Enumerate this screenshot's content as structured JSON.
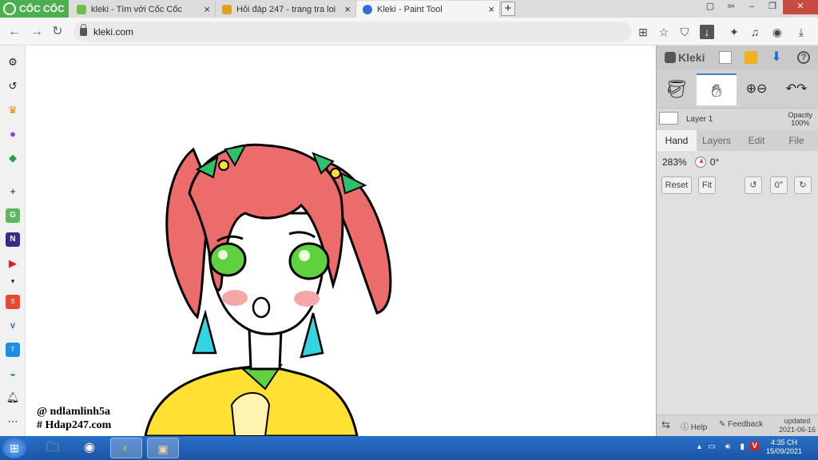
{
  "browser": {
    "brand": "CỐC CỐC",
    "tabs": [
      {
        "title": "kleki - Tìm với Cốc Cốc",
        "favicon": "coccoc-search-icon",
        "active": false
      },
      {
        "title": "Hỏi đáp 247 - trang tra loi",
        "favicon": "hoidap-icon",
        "active": false
      },
      {
        "title": "Kleki - Paint Tool",
        "favicon": "kleki-icon",
        "active": true
      }
    ],
    "new_tab": "+",
    "url": "kleki.com"
  },
  "canvas": {
    "watermark_line1": "@ ndlamlinh5a",
    "watermark_line2": "# Hdap247.com"
  },
  "kleki": {
    "logo": "Kleki",
    "layer_name": "Layer 1",
    "opacity_label": "Opacity",
    "opacity_value": "100%",
    "tabs": [
      "Hand",
      "Layers",
      "Edit",
      "File"
    ],
    "active_tab": "Hand",
    "zoom": "283%",
    "angle": "0°",
    "reset_label": "Reset",
    "fit_label": "Fit",
    "rotate_value": "0°",
    "help_label": "Help",
    "feedback_label": "Feedback",
    "updated_label": "updated",
    "updated_date": "2021-06-16"
  },
  "taskbar": {
    "time": "4:35 CH",
    "date": "15/09/2021"
  },
  "colors": {
    "brand_green": "#4caf50",
    "accent_blue": "#4a7fd0",
    "hair": "#ec6b6b",
    "eyes": "#5fd13f",
    "earring": "#33d6e0",
    "shirt": "#ffe033"
  }
}
